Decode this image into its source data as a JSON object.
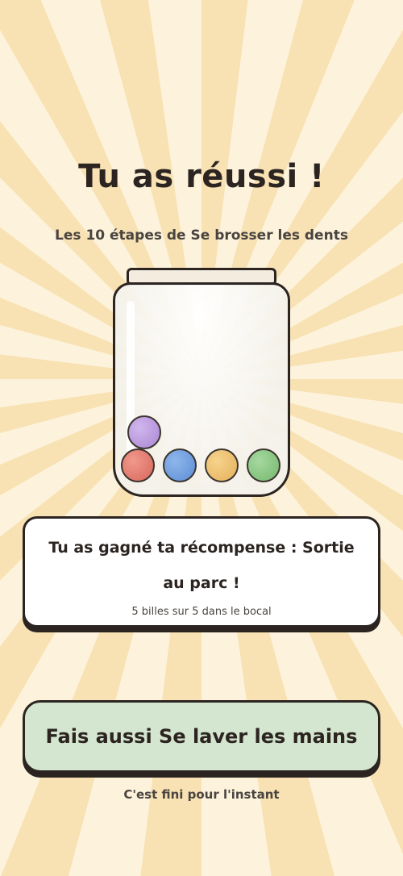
{
  "header": {
    "title": "Tu as réussi !",
    "subtitle": "Les 10 étapes de Se brosser les dents"
  },
  "jar": {
    "marbles": [
      {
        "color": "#d9665a",
        "name": "red"
      },
      {
        "color": "#5b8dd6",
        "name": "blue"
      },
      {
        "color": "#e4b15a",
        "name": "yellow"
      },
      {
        "color": "#74b86e",
        "name": "green"
      },
      {
        "color": "#a987d3",
        "name": "purple"
      }
    ]
  },
  "reward_card": {
    "message": "Tu as gagné ta récompense : Sortie au parc !",
    "count_text": "5 billes sur 5 dans le bocal"
  },
  "action": {
    "button_label": "Fais aussi Se laver les mains",
    "footer_text": "C'est fini pour l'instant"
  },
  "colors": {
    "background": "#fdf3dc",
    "rays": "#f8e2b4",
    "button_bg": "#d4e6cf",
    "text": "#2b2420"
  }
}
